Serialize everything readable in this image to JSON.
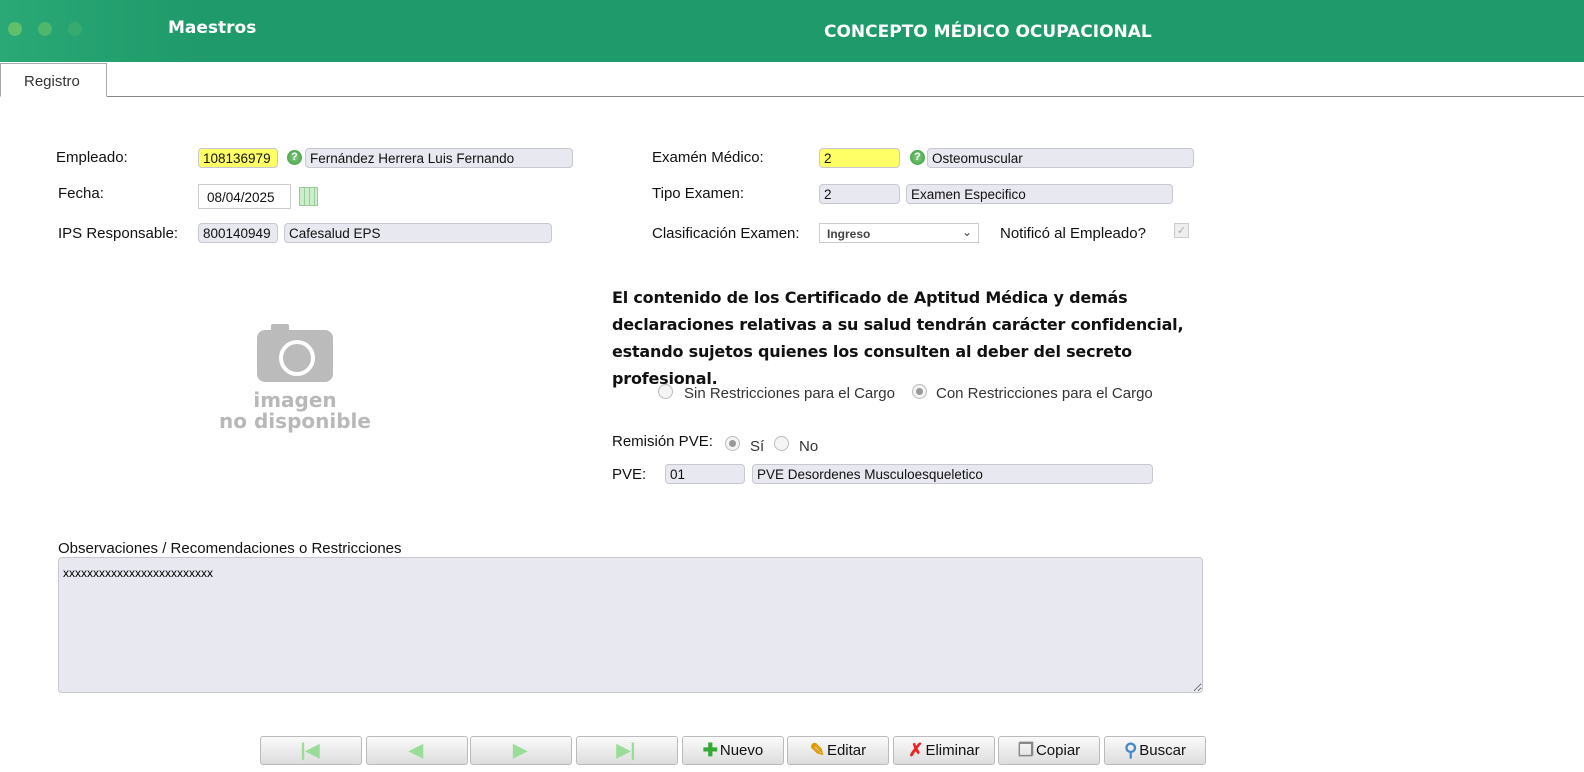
{
  "header": {
    "section": "Maestros",
    "title": "CONCEPTO MÉDICO OCUPACIONAL"
  },
  "tabs": [
    {
      "label": "Registro"
    }
  ],
  "form": {
    "empleado": {
      "label": "Empleado:",
      "code": "108136979",
      "name": "Fernández Herrera Luis Fernando"
    },
    "fecha": {
      "label": "Fecha:",
      "value": "08/04/2025"
    },
    "ips": {
      "label": "IPS Responsable:",
      "code": "800140949",
      "name": "Cafesalud EPS"
    },
    "examen": {
      "label": "Examén Médico:",
      "code": "2",
      "name": "Osteomuscular"
    },
    "tipo": {
      "label": "Tipo Examen:",
      "code": "2",
      "name": "Examen Especifico"
    },
    "clasificacion": {
      "label": "Clasificación Examen:",
      "value": "Ingreso"
    },
    "notifico": {
      "label": "Notificó al Empleado?",
      "checked": true
    },
    "notice": "El contenido de los Certificado de Aptitud Médica y demás declaraciones relativas a su salud tendrán carácter confidencial, estando sujetos quienes los consulten al deber del secreto profesional.",
    "restricciones": {
      "sin": "Sin Restricciones para el Cargo",
      "con": "Con Restricciones para el Cargo",
      "selected": "con"
    },
    "remision": {
      "label": "Remisión PVE:",
      "si": "Sí",
      "no": "No",
      "selected": "si"
    },
    "pve": {
      "label": "PVE:",
      "code": "01",
      "name": "PVE Desordenes Musculoesqueletico"
    },
    "observaciones": {
      "label": "Observaciones / Recomendaciones o Restricciones",
      "value": "xxxxxxxxxxxxxxxxxxxxxxxxx"
    }
  },
  "image": {
    "line1": "imagen",
    "line2": "no disponible"
  },
  "toolbar": {
    "nuevo": "Nuevo",
    "editar": "Editar",
    "eliminar": "Eliminar",
    "copiar": "Copiar",
    "buscar": "Buscar"
  }
}
